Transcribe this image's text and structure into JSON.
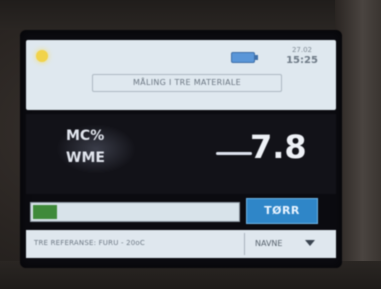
{
  "header": {
    "date": "27.02",
    "time": "15:25",
    "mode": "MÅLING I TRE MATERIALE"
  },
  "reading": {
    "label_mc": "MC%",
    "label_wme": "WME",
    "value": "7.8"
  },
  "status": {
    "badge": "TØRR",
    "fill_fraction": 0.12
  },
  "footer": {
    "reference": "TRE REFERANSE: FURU - 20oC",
    "dropdown": "NAVNE"
  },
  "colors": {
    "status_blue": "#2f86c8",
    "bar_green": "#3f8a3a",
    "screen_panel": "#dfe8ef"
  }
}
